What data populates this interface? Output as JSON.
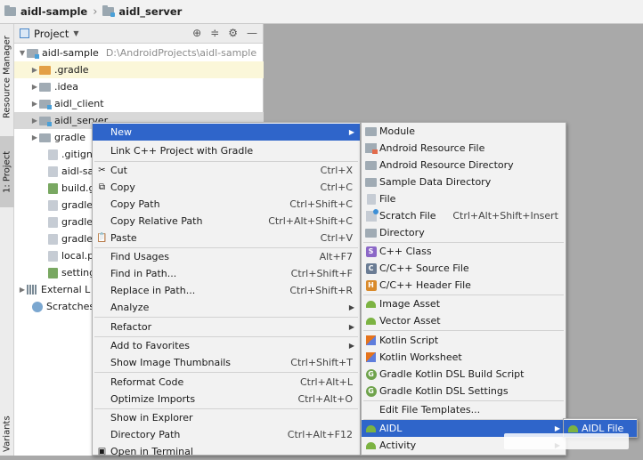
{
  "breadcrumb": {
    "root": "aidl-sample",
    "module": "aidl_server"
  },
  "tool_strip": {
    "resource_manager": "Resource Manager",
    "project": "1: Project",
    "build_variants": "Variants"
  },
  "project_panel": {
    "title": "Project",
    "tree": [
      {
        "label": "aidl-sample",
        "hint": "D:\\AndroidProjects\\aidl-sample"
      },
      {
        "label": ".gradle"
      },
      {
        "label": ".idea"
      },
      {
        "label": "aidl_client"
      },
      {
        "label": "aidl_server"
      },
      {
        "label": "gradle"
      },
      {
        "label": ".gitign"
      },
      {
        "label": "aidl-sa"
      },
      {
        "label": "build.g"
      },
      {
        "label": "gradle"
      },
      {
        "label": "gradle"
      },
      {
        "label": "gradle"
      },
      {
        "label": "local.p"
      },
      {
        "label": "setting"
      },
      {
        "label": "External L"
      },
      {
        "label": "Scratches"
      }
    ]
  },
  "context_menu": {
    "items": [
      {
        "label": "New"
      },
      {
        "label": "Link C++ Project with Gradle"
      },
      {
        "label": "Cut",
        "shortcut": "Ctrl+X"
      },
      {
        "label": "Copy",
        "shortcut": "Ctrl+C"
      },
      {
        "label": "Copy Path",
        "shortcut": "Ctrl+Shift+C"
      },
      {
        "label": "Copy Relative Path",
        "shortcut": "Ctrl+Alt+Shift+C"
      },
      {
        "label": "Paste",
        "shortcut": "Ctrl+V"
      },
      {
        "label": "Find Usages",
        "shortcut": "Alt+F7"
      },
      {
        "label": "Find in Path...",
        "shortcut": "Ctrl+Shift+F"
      },
      {
        "label": "Replace in Path...",
        "shortcut": "Ctrl+Shift+R"
      },
      {
        "label": "Analyze"
      },
      {
        "label": "Refactor"
      },
      {
        "label": "Add to Favorites"
      },
      {
        "label": "Show Image Thumbnails",
        "shortcut": "Ctrl+Shift+T"
      },
      {
        "label": "Reformat Code",
        "shortcut": "Ctrl+Alt+L"
      },
      {
        "label": "Optimize Imports",
        "shortcut": "Ctrl+Alt+O"
      },
      {
        "label": "Show in Explorer"
      },
      {
        "label": "Directory Path",
        "shortcut": "Ctrl+Alt+F12"
      },
      {
        "label": "Open in Terminal"
      }
    ]
  },
  "new_submenu": {
    "items": [
      {
        "label": "Module"
      },
      {
        "label": "Android Resource File"
      },
      {
        "label": "Android Resource Directory"
      },
      {
        "label": "Sample Data Directory"
      },
      {
        "label": "File"
      },
      {
        "label": "Scratch File",
        "shortcut": "Ctrl+Alt+Shift+Insert"
      },
      {
        "label": "Directory"
      },
      {
        "label": "C++ Class"
      },
      {
        "label": "C/C++ Source File"
      },
      {
        "label": "C/C++ Header File"
      },
      {
        "label": "Image Asset"
      },
      {
        "label": "Vector Asset"
      },
      {
        "label": "Kotlin Script"
      },
      {
        "label": "Kotlin Worksheet"
      },
      {
        "label": "Gradle Kotlin DSL Build Script"
      },
      {
        "label": "Gradle Kotlin DSL Settings"
      },
      {
        "label": "Edit File Templates..."
      },
      {
        "label": "AIDL"
      },
      {
        "label": "Activity"
      }
    ]
  },
  "aidl_submenu": {
    "items": [
      {
        "label": "AIDL File"
      }
    ]
  },
  "colors": {
    "selection": "#2f65ca",
    "menu_bg": "#f2f2f2",
    "editor_bg": "#a9a9a9"
  }
}
